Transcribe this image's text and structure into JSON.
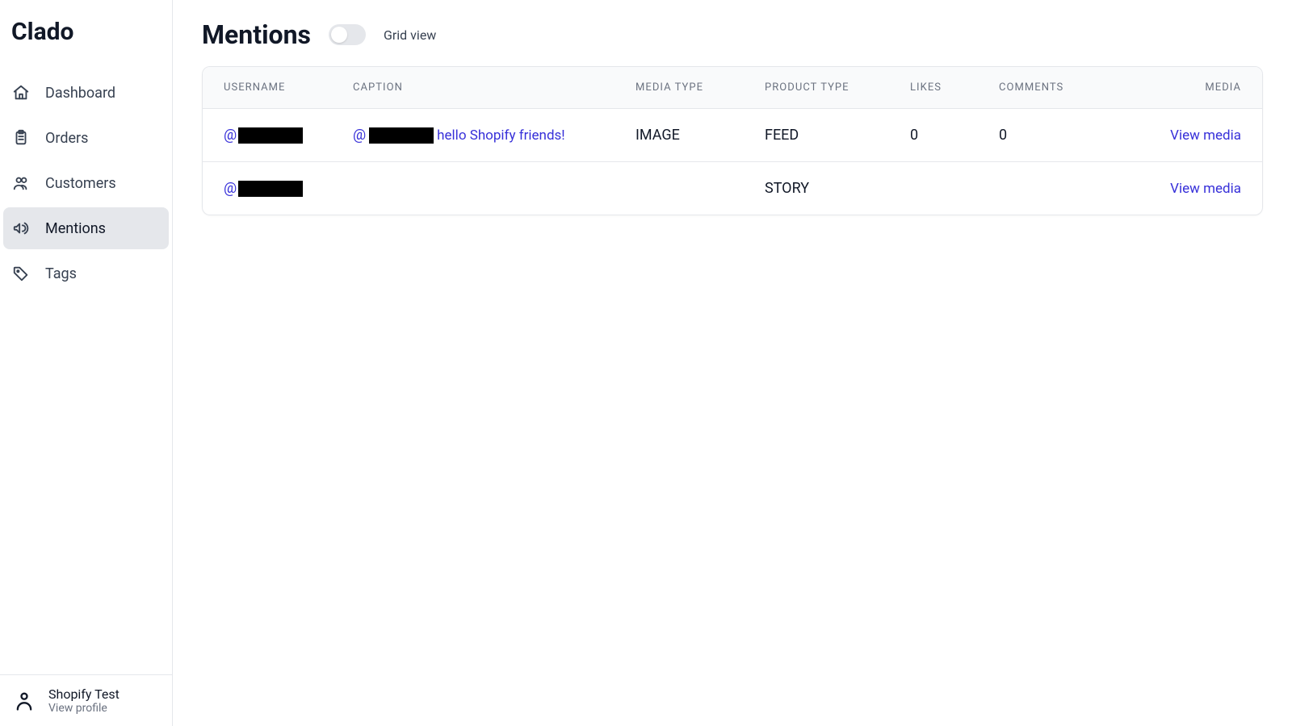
{
  "brand": "Clado",
  "sidebar": {
    "items": [
      {
        "label": "Dashboard"
      },
      {
        "label": "Orders"
      },
      {
        "label": "Customers"
      },
      {
        "label": "Mentions"
      },
      {
        "label": "Tags"
      }
    ]
  },
  "footer": {
    "name": "Shopify Test",
    "sub": "View profile"
  },
  "header": {
    "title": "Mentions",
    "toggle_label": "Grid view"
  },
  "table": {
    "columns": {
      "username": "Username",
      "caption": "Caption",
      "media_type": "Media Type",
      "product_type": "Product Type",
      "likes": "Likes",
      "comments": "Comments",
      "media": "Media"
    },
    "rows": [
      {
        "username_prefix": "@",
        "caption_prefix": "@",
        "caption_text": " hello Shopify friends!",
        "media_type": "IMAGE",
        "product_type": "FEED",
        "likes": "0",
        "comments": "0",
        "view_label": "View media"
      },
      {
        "username_prefix": "@",
        "caption_prefix": "",
        "caption_text": "",
        "media_type": "",
        "product_type": "STORY",
        "likes": "",
        "comments": "",
        "view_label": "View media"
      }
    ]
  }
}
